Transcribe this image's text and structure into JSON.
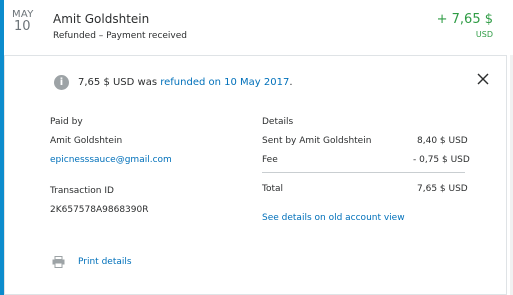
{
  "transaction": {
    "month": "MAY",
    "day": "10",
    "name": "Amit Goldshtein",
    "status": "Refunded – Payment received",
    "amount": "+ 7,65 $",
    "currency": "USD"
  },
  "notice": {
    "amount_text": "7,65 $ USD was ",
    "link_text": "refunded on 10 May 2017",
    "period": "."
  },
  "paid_by": {
    "label": "Paid by",
    "name": "Amit Goldshtein",
    "email": "epicnesssauce@gmail.com"
  },
  "transaction_id": {
    "label": "Transaction ID",
    "value": "2K657578A9868390R"
  },
  "details": {
    "label": "Details",
    "rows": [
      {
        "label": "Sent by Amit Goldshtein",
        "value": "8,40 $ USD"
      },
      {
        "label": "Fee",
        "value": "- 0,75 $ USD"
      }
    ],
    "total_label": "Total",
    "total_value": "7,65 $ USD",
    "old_view_link": "See details on old account view"
  },
  "print_link": "Print details",
  "colors": {
    "accent": "#0c8ccd",
    "positive": "#2f9c45",
    "link": "#0070ba"
  },
  "icons": [
    "info-icon",
    "close-icon",
    "printer-icon"
  ]
}
